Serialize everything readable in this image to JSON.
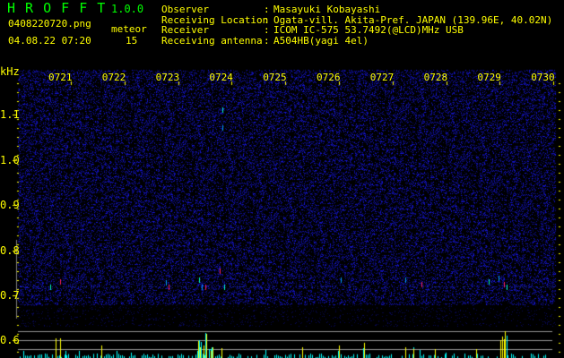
{
  "header": {
    "app_name": "H R O F F T",
    "version": "1.0.0",
    "filename": "0408220720.png",
    "datetime": "04.08.22 07:20",
    "meteor_label": "meteor",
    "meteor_count": "15",
    "info": [
      {
        "label": "Observer",
        "value": "Masayuki Kobayashi"
      },
      {
        "label": "Receiving Location",
        "value": "Ogata-vill. Akita-Pref. JAPAN (139.96E, 40.02N)"
      },
      {
        "label": "Receiver",
        "value": "ICOM IC-575 53.7492(@LCD)MHz USB"
      },
      {
        "label": "Receiving antenna",
        "value": "A504HB(yagi 4el)"
      }
    ]
  },
  "spectrogram": {
    "y_unit": "kHz",
    "y_ticks": [
      "1.1",
      "1.0",
      "0.9",
      "0.8",
      "0.7",
      "0.6"
    ],
    "time_labels": [
      "0721",
      "0722",
      "0723",
      "0724",
      "0725",
      "0726",
      "0727",
      "0728",
      "0729",
      "0730"
    ],
    "colors": {
      "noise": "#1a1aff",
      "axis": "#ffff00",
      "bars_low": "#00ffff",
      "bars_high": "#ffff00",
      "echo": "#ff2060"
    }
  }
}
